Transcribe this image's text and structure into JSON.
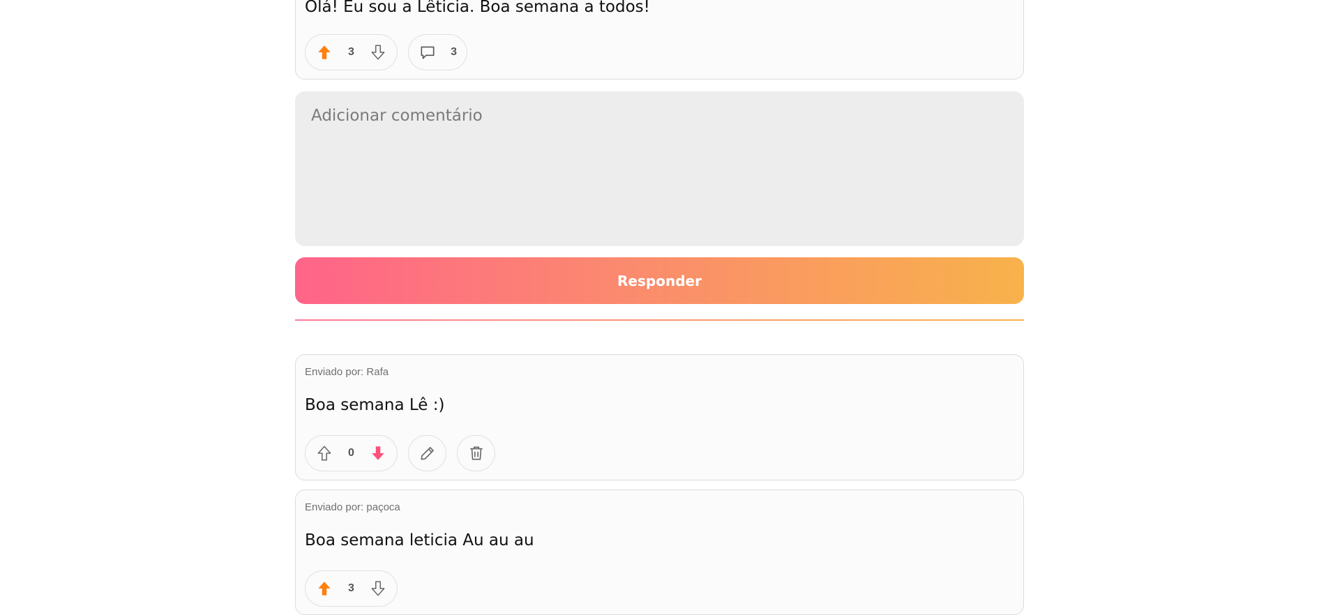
{
  "post": {
    "body": "Olá! Eu sou a Lêticia. Boa semana a todos!",
    "votes": "3",
    "comments": "3"
  },
  "comment_form": {
    "placeholder": "Adicionar comentário",
    "submit_label": "Responder"
  },
  "comments": [
    {
      "author_line": "Enviado por: Rafa",
      "body": "Boa semana Lê :)",
      "votes": "0"
    },
    {
      "author_line": "Enviado por: paçoca",
      "body": "Boa semana leticia Au au au",
      "votes": "3"
    }
  ],
  "colors": {
    "upvote_active": "#ff7f11",
    "downvote_active": "#ff4f7b",
    "gradient_start": "#ff6489",
    "gradient_end": "#f8b24b"
  },
  "icons": [
    "arrow-up-icon",
    "arrow-down-icon",
    "comment-icon",
    "pencil-icon",
    "trash-icon"
  ]
}
